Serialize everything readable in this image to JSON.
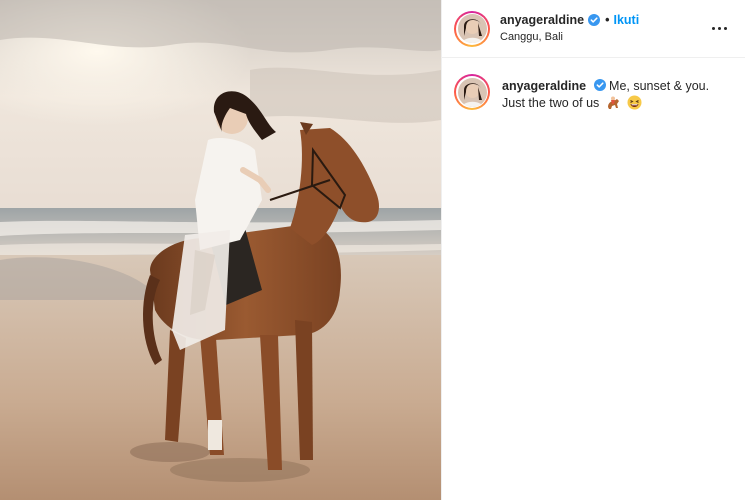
{
  "post": {
    "author": {
      "username": "anyageraldine",
      "verified": true,
      "follow_label": "Ikuti",
      "dot_separator": "•",
      "location": "Canggu, Bali"
    },
    "more_options_icon": "three-dots-icon",
    "caption": {
      "username": "anyageraldine",
      "text": "Me, sunset & you. Just the two of us",
      "emojis": [
        "horse-rider-emoji",
        "laughing-face-emoji"
      ]
    },
    "image_description_icon": "photo"
  },
  "colors": {
    "accent": "#0095f6",
    "verified_badge": "#3897f0",
    "text": "#262626",
    "divider": "#efefef"
  }
}
